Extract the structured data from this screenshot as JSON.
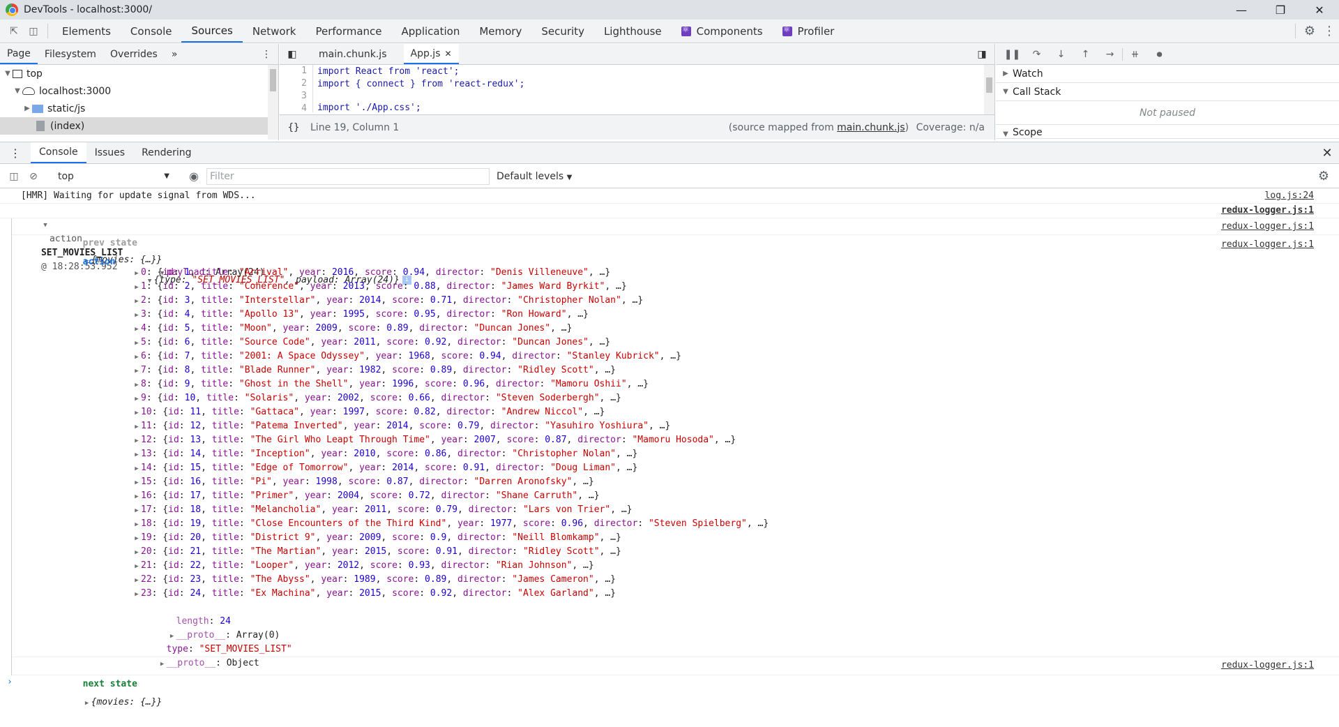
{
  "window": {
    "title": "DevTools - localhost:3000/"
  },
  "main_tabs": [
    {
      "label": "Elements"
    },
    {
      "label": "Console"
    },
    {
      "label": "Sources"
    },
    {
      "label": "Network"
    },
    {
      "label": "Performance"
    },
    {
      "label": "Application"
    },
    {
      "label": "Memory"
    },
    {
      "label": "Security"
    },
    {
      "label": "Lighthouse"
    },
    {
      "label": "Components"
    },
    {
      "label": "Profiler"
    }
  ],
  "navigator": {
    "tabs": [
      {
        "label": "Page"
      },
      {
        "label": "Filesystem"
      },
      {
        "label": "Overrides"
      }
    ],
    "tree": [
      {
        "label": "top"
      },
      {
        "label": "localhost:3000"
      },
      {
        "label": "static/js"
      },
      {
        "label": "(index)"
      }
    ]
  },
  "editor": {
    "tabs": [
      {
        "label": "main.chunk.js"
      },
      {
        "label": "App.js"
      }
    ],
    "lines": [
      {
        "n": "1",
        "text": "import React from 'react';"
      },
      {
        "n": "2",
        "text": "import { connect } from 'react-redux';"
      },
      {
        "n": "3",
        "text": ""
      },
      {
        "n": "4",
        "text": "import './App.css';"
      }
    ],
    "status": {
      "braces": "{}",
      "position": "Line 19, Column 1",
      "source_prefix": "(source mapped from ",
      "source_link": "main.chunk.js",
      "source_suffix": ")",
      "coverage": "Coverage: n/a"
    }
  },
  "debugger": {
    "watch": "Watch",
    "call_stack": "Call Stack",
    "not_paused": "Not paused",
    "scope": "Scope"
  },
  "drawer": {
    "tabs": [
      {
        "label": "Console"
      },
      {
        "label": "Issues"
      },
      {
        "label": "Rendering"
      }
    ],
    "context": "top",
    "filter_placeholder": "Filter",
    "levels": "Default levels"
  },
  "console": {
    "hmr": {
      "text": "[HMR] Waiting for update signal from WDS...",
      "source": "log.js:24"
    },
    "group": {
      "prefix": "action",
      "action": "SET_MOVIES_LIST",
      "time": "@ 18:28:53.952",
      "source": "redux-logger.js:1"
    },
    "prev_state": {
      "label": "prev state",
      "value": "{movies: {…}}",
      "source": "redux-logger.js:1"
    },
    "action_entry": {
      "label": "action",
      "value_open": "{type: ",
      "type_value": "\"SET_MOVIES_LIST\"",
      "mid": ", payload: Array(24)}",
      "source": "redux-logger.js:1",
      "payload_key": "payload",
      "payload_type": "Array(24)"
    },
    "movies": [
      {
        "idx": "0",
        "id": "1",
        "title": "\"Arrival\"",
        "year": "2016",
        "score": "0.94",
        "director": "\"Denis Villeneuve\""
      },
      {
        "idx": "1",
        "id": "2",
        "title": "\"Coherence\"",
        "year": "2013",
        "score": "0.88",
        "director": "\"James Ward Byrkit\""
      },
      {
        "idx": "2",
        "id": "3",
        "title": "\"Interstellar\"",
        "year": "2014",
        "score": "0.71",
        "director": "\"Christopher Nolan\""
      },
      {
        "idx": "3",
        "id": "4",
        "title": "\"Apollo 13\"",
        "year": "1995",
        "score": "0.95",
        "director": "\"Ron Howard\""
      },
      {
        "idx": "4",
        "id": "5",
        "title": "\"Moon\"",
        "year": "2009",
        "score": "0.89",
        "director": "\"Duncan Jones\""
      },
      {
        "idx": "5",
        "id": "6",
        "title": "\"Source Code\"",
        "year": "2011",
        "score": "0.92",
        "director": "\"Duncan Jones\""
      },
      {
        "idx": "6",
        "id": "7",
        "title": "\"2001: A Space Odyssey\"",
        "year": "1968",
        "score": "0.94",
        "director": "\"Stanley Kubrick\""
      },
      {
        "idx": "7",
        "id": "8",
        "title": "\"Blade Runner\"",
        "year": "1982",
        "score": "0.89",
        "director": "\"Ridley Scott\""
      },
      {
        "idx": "8",
        "id": "9",
        "title": "\"Ghost in the Shell\"",
        "year": "1996",
        "score": "0.96",
        "director": "\"Mamoru Oshii\""
      },
      {
        "idx": "9",
        "id": "10",
        "title": "\"Solaris\"",
        "year": "2002",
        "score": "0.66",
        "director": "\"Steven Soderbergh\""
      },
      {
        "idx": "10",
        "id": "11",
        "title": "\"Gattaca\"",
        "year": "1997",
        "score": "0.82",
        "director": "\"Andrew Niccol\""
      },
      {
        "idx": "11",
        "id": "12",
        "title": "\"Patema Inverted\"",
        "year": "2014",
        "score": "0.79",
        "director": "\"Yasuhiro Yoshiura\""
      },
      {
        "idx": "12",
        "id": "13",
        "title": "\"The Girl Who Leapt Through Time\"",
        "year": "2007",
        "score": "0.87",
        "director": "\"Mamoru Hosoda\""
      },
      {
        "idx": "13",
        "id": "14",
        "title": "\"Inception\"",
        "year": "2010",
        "score": "0.86",
        "director": "\"Christopher Nolan\""
      },
      {
        "idx": "14",
        "id": "15",
        "title": "\"Edge of Tomorrow\"",
        "year": "2014",
        "score": "0.91",
        "director": "\"Doug Liman\""
      },
      {
        "idx": "15",
        "id": "16",
        "title": "\"Pi\"",
        "year": "1998",
        "score": "0.87",
        "director": "\"Darren Aronofsky\""
      },
      {
        "idx": "16",
        "id": "17",
        "title": "\"Primer\"",
        "year": "2004",
        "score": "0.72",
        "director": "\"Shane Carruth\""
      },
      {
        "idx": "17",
        "id": "18",
        "title": "\"Melancholia\"",
        "year": "2011",
        "score": "0.79",
        "director": "\"Lars von Trier\""
      },
      {
        "idx": "18",
        "id": "19",
        "title": "\"Close Encounters of the Third Kind\"",
        "year": "1977",
        "score": "0.96",
        "director": "\"Steven Spielberg\""
      },
      {
        "idx": "19",
        "id": "20",
        "title": "\"District 9\"",
        "year": "2009",
        "score": "0.9",
        "director": "\"Neill Blomkamp\""
      },
      {
        "idx": "20",
        "id": "21",
        "title": "\"The Martian\"",
        "year": "2015",
        "score": "0.91",
        "director": "\"Ridley Scott\""
      },
      {
        "idx": "21",
        "id": "22",
        "title": "\"Looper\"",
        "year": "2012",
        "score": "0.93",
        "director": "\"Rian Johnson\""
      },
      {
        "idx": "22",
        "id": "23",
        "title": "\"The Abyss\"",
        "year": "1989",
        "score": "0.89",
        "director": "\"James Cameron\""
      },
      {
        "idx": "23",
        "id": "24",
        "title": "\"Ex Machina\"",
        "year": "2015",
        "score": "0.92",
        "director": "\"Alex Garland\""
      }
    ],
    "length_key": "length",
    "length_value": "24",
    "proto_key": "__proto__",
    "proto_array": "Array(0)",
    "type_key": "type",
    "type_value": "\"SET_MOVIES_LIST\"",
    "proto_object": "Object",
    "next_state": {
      "label": "next state",
      "value": "{movies: {…}}",
      "source": "redux-logger.js:1"
    },
    "prompt": "›"
  }
}
